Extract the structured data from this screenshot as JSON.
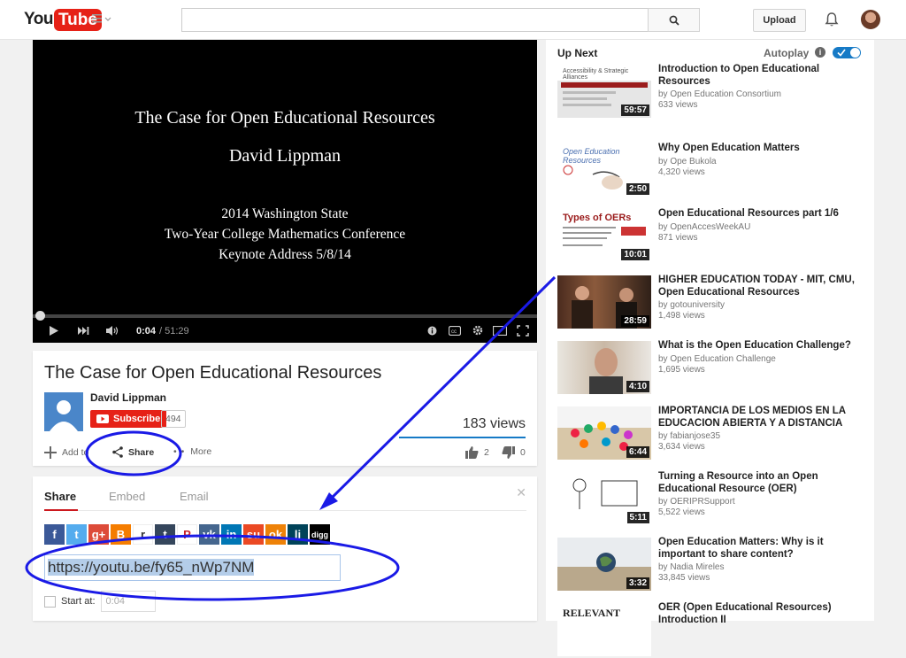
{
  "header": {
    "logo_you": "You",
    "logo_tube": "Tube",
    "search_placeholder": "",
    "upload_label": "Upload"
  },
  "player": {
    "slide_title": "The Case for Open Educational Resources",
    "slide_author": "David Lippman",
    "slide_line1": "2014 Washington State",
    "slide_line2": "Two-Year College Mathematics Conference",
    "slide_line3": "Keynote Address 5/8/14",
    "current_time": "0:04",
    "duration": "/ 51:29",
    "progress_fraction": 0.0013
  },
  "video": {
    "title": "The Case for Open Educational Resources",
    "channel": "David Lippman",
    "subscribe_label": "Subscribe",
    "subscriber_count": "494",
    "views": "183 views",
    "add_label": "Add to",
    "share_label": "Share",
    "more_label": "More",
    "likes": "2",
    "dislikes": "0"
  },
  "share": {
    "tabs": [
      "Share",
      "Embed",
      "Email"
    ],
    "url": "https://youtu.be/fy65_nWp7NM",
    "start_label": "Start at:",
    "start_time": "0:04",
    "social": [
      {
        "name": "facebook-icon",
        "glyph": "f",
        "color": "#3b5998"
      },
      {
        "name": "twitter-icon",
        "glyph": "t",
        "color": "#55acee"
      },
      {
        "name": "google-plus-icon",
        "glyph": "g+",
        "color": "#dd4b39"
      },
      {
        "name": "blogger-icon",
        "glyph": "B",
        "color": "#f57d00"
      },
      {
        "name": "reddit-icon",
        "glyph": "r",
        "color": "#ffffff"
      },
      {
        "name": "tumblr-icon",
        "glyph": "t",
        "color": "#35465c"
      },
      {
        "name": "pinterest-icon",
        "glyph": "P",
        "color": "#ffffff"
      },
      {
        "name": "vk-icon",
        "glyph": "vk",
        "color": "#45668e"
      },
      {
        "name": "linkedin-icon",
        "glyph": "in",
        "color": "#0077b5"
      },
      {
        "name": "stumbleupon-icon",
        "glyph": "su",
        "color": "#eb4924"
      },
      {
        "name": "odnoklassniki-icon",
        "glyph": "ok",
        "color": "#ee8208"
      },
      {
        "name": "livejournal-icon",
        "glyph": "lj",
        "color": "#004359"
      },
      {
        "name": "digg-icon",
        "glyph": "digg",
        "color": "#000000"
      }
    ]
  },
  "upnext": {
    "label": "Up Next",
    "autoplay_label": "Autoplay",
    "videos": [
      {
        "title": "Introduction to Open Educational Resources",
        "channel": "by Open Education Consortium",
        "views": "633 views",
        "duration": "59:57",
        "thumb_text": "Accessibility & Strategic Alliances"
      },
      {
        "title": "Why Open Education Matters",
        "channel": "by Ope Bukola",
        "views": "4,320 views",
        "duration": "2:50",
        "thumb_text": "Open Education Resources"
      },
      {
        "title": "Open Educational Resources part 1/6",
        "channel": "by OpenAccesWeekAU",
        "views": "871 views",
        "duration": "10:01",
        "thumb_text": "Types of OERs"
      },
      {
        "title": "HIGHER EDUCATION TODAY - MIT, CMU, Open Educational Resources",
        "channel": "by gotouniversity",
        "views": "1,498 views",
        "duration": "28:59",
        "thumb_text": ""
      },
      {
        "title": "What is the Open Education Challenge?",
        "channel": "by Open Education Challenge",
        "views": "1,695 views",
        "duration": "4:10",
        "thumb_text": ""
      },
      {
        "title": "IMPORTANCIA DE LOS MEDIOS EN LA EDUCACION ABIERTA Y A DISTANCIA",
        "channel": "by fabianjose35",
        "views": "3,634 views",
        "duration": "6:44",
        "thumb_text": ""
      },
      {
        "title": "Turning a Resource into an Open Educational Resource (OER)",
        "channel": "by OERIPRSupport",
        "views": "5,522 views",
        "duration": "5:11",
        "thumb_text": ""
      },
      {
        "title": "Open Education Matters: Why is it important to share content?",
        "channel": "by Nadia Mireles",
        "views": "33,845 views",
        "duration": "3:32",
        "thumb_text": ""
      },
      {
        "title": "OER (Open Educational Resources) Introduction II",
        "channel": "",
        "views": "",
        "duration": "",
        "thumb_text": "RELEVANT"
      }
    ]
  },
  "annotation_color": "#1a1ae6"
}
